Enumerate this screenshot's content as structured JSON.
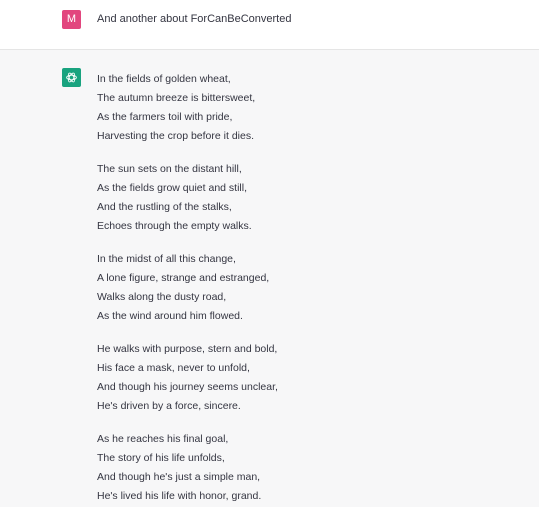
{
  "colors": {
    "user_avatar_bg": "#e2467e",
    "assistant_avatar_bg": "#19a37f",
    "assistant_row_bg": "#f7f7f8"
  },
  "user": {
    "avatar_letter": "M",
    "message": "And another about ForCanBeConverted"
  },
  "assistant": {
    "avatar_icon": "openai-logo-icon",
    "stanzas": [
      {
        "lines": [
          "In the fields of golden wheat,",
          "The autumn breeze is bittersweet,",
          "As the farmers toil with pride,",
          "Harvesting the crop before it dies."
        ]
      },
      {
        "lines": [
          "The sun sets on the distant hill,",
          "As the fields grow quiet and still,",
          "And the rustling of the stalks,",
          "Echoes through the empty walks."
        ]
      },
      {
        "lines": [
          "In the midst of all this change,",
          "A lone figure, strange and estranged,",
          "Walks along the dusty road,",
          "As the wind around him flowed."
        ]
      },
      {
        "lines": [
          "He walks with purpose, stern and bold,",
          "His face a mask, never to unfold,",
          "And though his journey seems unclear,",
          "He's driven by a force, sincere."
        ]
      },
      {
        "lines": [
          "As he reaches his final goal,",
          "The story of his life unfolds,",
          "And though he's just a simple man,",
          "He's lived his life with honor, grand."
        ]
      }
    ]
  }
}
